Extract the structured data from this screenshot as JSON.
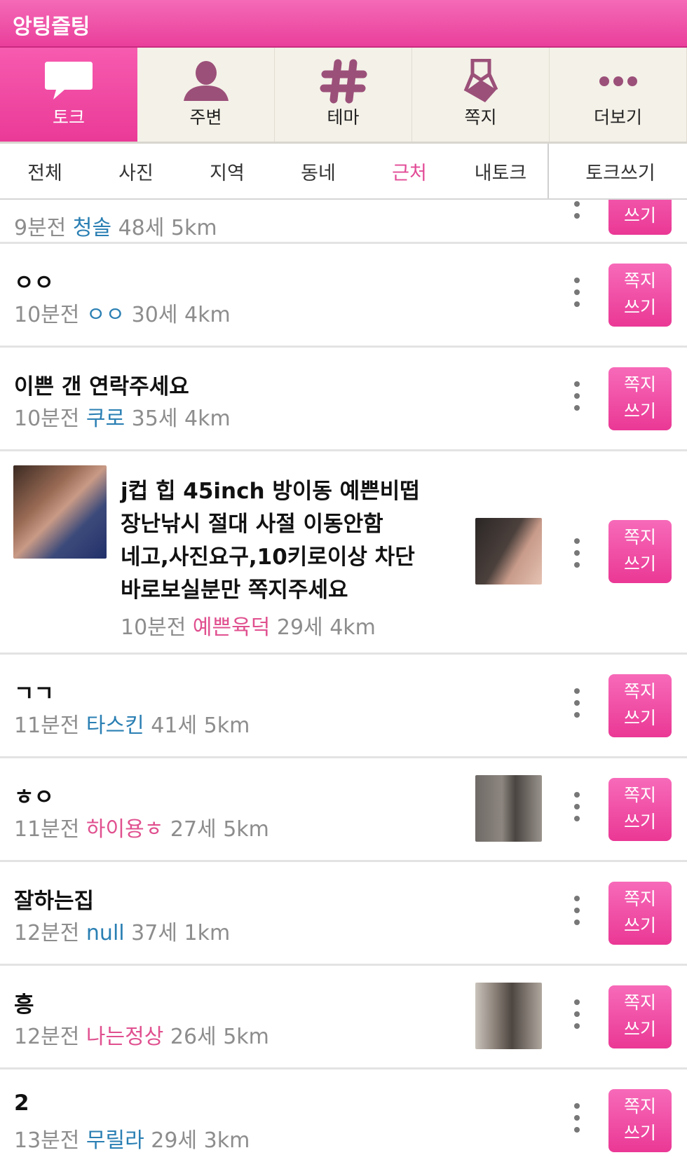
{
  "app": {
    "title": "앙팅즐팅"
  },
  "tabs": [
    {
      "label": "토크",
      "icon": "chat-bubble-icon",
      "active": true
    },
    {
      "label": "주변",
      "icon": "person-icon",
      "active": false
    },
    {
      "label": "테마",
      "icon": "hash-icon",
      "active": false
    },
    {
      "label": "쪽지",
      "icon": "note-icon",
      "active": false
    },
    {
      "label": "더보기",
      "icon": "more-dots-icon",
      "active": false
    }
  ],
  "subtabs": [
    {
      "label": "전체",
      "active": false
    },
    {
      "label": "사진",
      "active": false
    },
    {
      "label": "지역",
      "active": false
    },
    {
      "label": "동네",
      "active": false
    },
    {
      "label": "근처",
      "active": true
    },
    {
      "label": "내토크",
      "active": false
    }
  ],
  "write_talk_label": "토크쓰기",
  "message_button": {
    "line1": "쪽지",
    "line2": "쓰기"
  },
  "posts": [
    {
      "title": "",
      "time": "9분전",
      "nick": "청솔",
      "nick_color": "#2a7fb3",
      "age": "48세",
      "distance": "5km"
    },
    {
      "title": "ㅇㅇ",
      "time": "10분전",
      "nick": "ㅇㅇ",
      "nick_color": "#2a7fb3",
      "age": "30세",
      "distance": "4km"
    },
    {
      "title": "이쁜 갠 연락주세요",
      "time": "10분전",
      "nick": "쿠로",
      "nick_color": "#2a7fb3",
      "age": "35세",
      "distance": "4km"
    },
    {
      "title_lines": [
        "j컵 힙 45inch  방이동 예쁜비떱",
        "장난낚시 절대 사절 이동안함",
        "네고,사진요구,10키로이상 차단",
        "바로보실분만 쪽지주세요"
      ],
      "time": "10분전",
      "nick": "예쁜육덕",
      "nick_color": "#e0508f",
      "age": "29세",
      "distance": "4km"
    },
    {
      "title": "ㄱㄱ",
      "time": "11분전",
      "nick": "타스킨",
      "nick_color": "#2a7fb3",
      "age": "41세",
      "distance": "5km"
    },
    {
      "title": "ㅎㅇ",
      "time": "11분전",
      "nick": "하이용ㅎ",
      "nick_color": "#e0508f",
      "age": "27세",
      "distance": "5km"
    },
    {
      "title": "잘하는집",
      "time": "12분전",
      "nick": "null",
      "nick_color": "#2a7fb3",
      "age": "37세",
      "distance": "1km"
    },
    {
      "title": "흥",
      "time": "12분전",
      "nick": "나는정상",
      "nick_color": "#e0508f",
      "age": "26세",
      "distance": "5km"
    },
    {
      "title": "2",
      "time": "13분전",
      "nick": "무릴라",
      "nick_color": "#2a7fb3",
      "age": "29세",
      "distance": "3km"
    }
  ],
  "colors": {
    "accent": "#ea3f9b",
    "tab_bg": "#f4f1e8",
    "nick_blue": "#2a7fb3",
    "nick_pink": "#e0508f",
    "icon_mauve": "#9b5079"
  }
}
